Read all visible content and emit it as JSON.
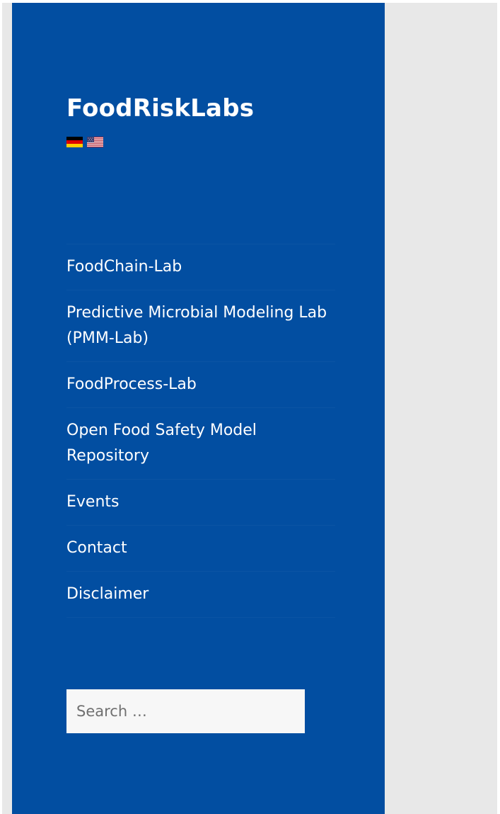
{
  "site": {
    "title": "FoodRiskLabs"
  },
  "languages": [
    {
      "code": "de",
      "icon": "germany-flag-icon"
    },
    {
      "code": "en",
      "icon": "usa-flag-icon"
    }
  ],
  "nav": {
    "items": [
      {
        "label": "FoodChain-Lab"
      },
      {
        "label": "Predictive Microbial Modeling Lab (PMM-Lab)"
      },
      {
        "label": "FoodProcess-Lab"
      },
      {
        "label": "Open Food Safety Model Repository"
      },
      {
        "label": "Events"
      },
      {
        "label": "Contact"
      },
      {
        "label": "Disclaimer"
      }
    ]
  },
  "search": {
    "value": "",
    "placeholder": "Search …"
  },
  "colors": {
    "sidebar": "#024ea1",
    "page_background": "#e8e8e8",
    "search_background": "#f7f7f7"
  }
}
